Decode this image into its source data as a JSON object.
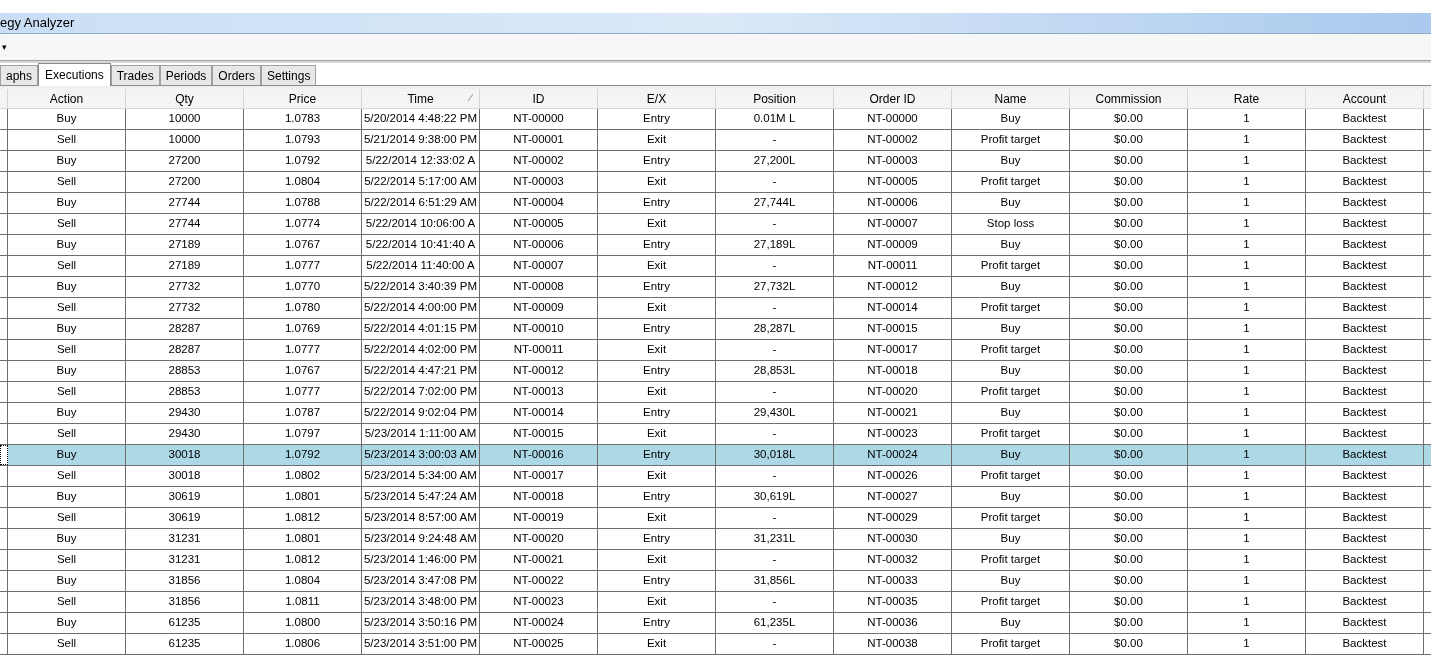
{
  "window": {
    "title": "egy Analyzer"
  },
  "toolbar": {
    "dropdown_caret": "▾"
  },
  "tabs": [
    {
      "label": "aphs",
      "selected": false
    },
    {
      "label": "Executions",
      "selected": true
    },
    {
      "label": "Trades",
      "selected": false
    },
    {
      "label": "Periods",
      "selected": false
    },
    {
      "label": "Orders",
      "selected": false
    },
    {
      "label": "Settings",
      "selected": false
    }
  ],
  "table": {
    "columns": [
      {
        "label": "Action",
        "sorted": false
      },
      {
        "label": "Qty",
        "sorted": false
      },
      {
        "label": "Price",
        "sorted": false
      },
      {
        "label": "Time",
        "sorted": true
      },
      {
        "label": "ID",
        "sorted": false
      },
      {
        "label": "E/X",
        "sorted": false
      },
      {
        "label": "Position",
        "sorted": false
      },
      {
        "label": "Order ID",
        "sorted": false
      },
      {
        "label": "Name",
        "sorted": false
      },
      {
        "label": "Commission",
        "sorted": false
      },
      {
        "label": "Rate",
        "sorted": false
      },
      {
        "label": "Account",
        "sorted": false
      }
    ],
    "rows": [
      {
        "selected": false,
        "cells": [
          "Buy",
          "10000",
          "1.0783",
          "5/20/2014 4:48:22 PM",
          "NT-00000",
          "Entry",
          "0.01M L",
          "NT-00000",
          "Buy",
          "$0.00",
          "1",
          "Backtest"
        ]
      },
      {
        "selected": false,
        "cells": [
          "Sell",
          "10000",
          "1.0793",
          "5/21/2014 9:38:00 PM",
          "NT-00001",
          "Exit",
          "-",
          "NT-00002",
          "Profit target",
          "$0.00",
          "1",
          "Backtest"
        ]
      },
      {
        "selected": false,
        "cells": [
          "Buy",
          "27200",
          "1.0792",
          "5/22/2014 12:33:02 A",
          "NT-00002",
          "Entry",
          "27,200L",
          "NT-00003",
          "Buy",
          "$0.00",
          "1",
          "Backtest"
        ]
      },
      {
        "selected": false,
        "cells": [
          "Sell",
          "27200",
          "1.0804",
          "5/22/2014 5:17:00 AM",
          "NT-00003",
          "Exit",
          "-",
          "NT-00005",
          "Profit target",
          "$0.00",
          "1",
          "Backtest"
        ]
      },
      {
        "selected": false,
        "cells": [
          "Buy",
          "27744",
          "1.0788",
          "5/22/2014 6:51:29 AM",
          "NT-00004",
          "Entry",
          "27,744L",
          "NT-00006",
          "Buy",
          "$0.00",
          "1",
          "Backtest"
        ]
      },
      {
        "selected": false,
        "cells": [
          "Sell",
          "27744",
          "1.0774",
          "5/22/2014 10:06:00 A",
          "NT-00005",
          "Exit",
          "-",
          "NT-00007",
          "Stop loss",
          "$0.00",
          "1",
          "Backtest"
        ]
      },
      {
        "selected": false,
        "cells": [
          "Buy",
          "27189",
          "1.0767",
          "5/22/2014 10:41:40 A",
          "NT-00006",
          "Entry",
          "27,189L",
          "NT-00009",
          "Buy",
          "$0.00",
          "1",
          "Backtest"
        ]
      },
      {
        "selected": false,
        "cells": [
          "Sell",
          "27189",
          "1.0777",
          "5/22/2014 11:40:00 A",
          "NT-00007",
          "Exit",
          "-",
          "NT-00011",
          "Profit target",
          "$0.00",
          "1",
          "Backtest"
        ]
      },
      {
        "selected": false,
        "cells": [
          "Buy",
          "27732",
          "1.0770",
          "5/22/2014 3:40:39 PM",
          "NT-00008",
          "Entry",
          "27,732L",
          "NT-00012",
          "Buy",
          "$0.00",
          "1",
          "Backtest"
        ]
      },
      {
        "selected": false,
        "cells": [
          "Sell",
          "27732",
          "1.0780",
          "5/22/2014 4:00:00 PM",
          "NT-00009",
          "Exit",
          "-",
          "NT-00014",
          "Profit target",
          "$0.00",
          "1",
          "Backtest"
        ]
      },
      {
        "selected": false,
        "cells": [
          "Buy",
          "28287",
          "1.0769",
          "5/22/2014 4:01:15 PM",
          "NT-00010",
          "Entry",
          "28,287L",
          "NT-00015",
          "Buy",
          "$0.00",
          "1",
          "Backtest"
        ]
      },
      {
        "selected": false,
        "cells": [
          "Sell",
          "28287",
          "1.0777",
          "5/22/2014 4:02:00 PM",
          "NT-00011",
          "Exit",
          "-",
          "NT-00017",
          "Profit target",
          "$0.00",
          "1",
          "Backtest"
        ]
      },
      {
        "selected": false,
        "cells": [
          "Buy",
          "28853",
          "1.0767",
          "5/22/2014 4:47:21 PM",
          "NT-00012",
          "Entry",
          "28,853L",
          "NT-00018",
          "Buy",
          "$0.00",
          "1",
          "Backtest"
        ]
      },
      {
        "selected": false,
        "cells": [
          "Sell",
          "28853",
          "1.0777",
          "5/22/2014 7:02:00 PM",
          "NT-00013",
          "Exit",
          "-",
          "NT-00020",
          "Profit target",
          "$0.00",
          "1",
          "Backtest"
        ]
      },
      {
        "selected": false,
        "cells": [
          "Buy",
          "29430",
          "1.0787",
          "5/22/2014 9:02:04 PM",
          "NT-00014",
          "Entry",
          "29,430L",
          "NT-00021",
          "Buy",
          "$0.00",
          "1",
          "Backtest"
        ]
      },
      {
        "selected": false,
        "cells": [
          "Sell",
          "29430",
          "1.0797",
          "5/23/2014 1:11:00 AM",
          "NT-00015",
          "Exit",
          "-",
          "NT-00023",
          "Profit target",
          "$0.00",
          "1",
          "Backtest"
        ]
      },
      {
        "selected": true,
        "cells": [
          "Buy",
          "30018",
          "1.0792",
          "5/23/2014 3:00:03 AM",
          "NT-00016",
          "Entry",
          "30,018L",
          "NT-00024",
          "Buy",
          "$0.00",
          "1",
          "Backtest"
        ]
      },
      {
        "selected": false,
        "cells": [
          "Sell",
          "30018",
          "1.0802",
          "5/23/2014 5:34:00 AM",
          "NT-00017",
          "Exit",
          "-",
          "NT-00026",
          "Profit target",
          "$0.00",
          "1",
          "Backtest"
        ]
      },
      {
        "selected": false,
        "cells": [
          "Buy",
          "30619",
          "1.0801",
          "5/23/2014 5:47:24 AM",
          "NT-00018",
          "Entry",
          "30,619L",
          "NT-00027",
          "Buy",
          "$0.00",
          "1",
          "Backtest"
        ]
      },
      {
        "selected": false,
        "cells": [
          "Sell",
          "30619",
          "1.0812",
          "5/23/2014 8:57:00 AM",
          "NT-00019",
          "Exit",
          "-",
          "NT-00029",
          "Profit target",
          "$0.00",
          "1",
          "Backtest"
        ]
      },
      {
        "selected": false,
        "cells": [
          "Buy",
          "31231",
          "1.0801",
          "5/23/2014 9:24:48 AM",
          "NT-00020",
          "Entry",
          "31,231L",
          "NT-00030",
          "Buy",
          "$0.00",
          "1",
          "Backtest"
        ]
      },
      {
        "selected": false,
        "cells": [
          "Sell",
          "31231",
          "1.0812",
          "5/23/2014 1:46:00 PM",
          "NT-00021",
          "Exit",
          "-",
          "NT-00032",
          "Profit target",
          "$0.00",
          "1",
          "Backtest"
        ]
      },
      {
        "selected": false,
        "cells": [
          "Buy",
          "31856",
          "1.0804",
          "5/23/2014 3:47:08 PM",
          "NT-00022",
          "Entry",
          "31,856L",
          "NT-00033",
          "Buy",
          "$0.00",
          "1",
          "Backtest"
        ]
      },
      {
        "selected": false,
        "cells": [
          "Sell",
          "31856",
          "1.0811",
          "5/23/2014 3:48:00 PM",
          "NT-00023",
          "Exit",
          "-",
          "NT-00035",
          "Profit target",
          "$0.00",
          "1",
          "Backtest"
        ]
      },
      {
        "selected": false,
        "cells": [
          "Buy",
          "61235",
          "1.0800",
          "5/23/2014 3:50:16 PM",
          "NT-00024",
          "Entry",
          "61,235L",
          "NT-00036",
          "Buy",
          "$0.00",
          "1",
          "Backtest"
        ]
      },
      {
        "selected": false,
        "cells": [
          "Sell",
          "61235",
          "1.0806",
          "5/23/2014 3:51:00 PM",
          "NT-00025",
          "Exit",
          "-",
          "NT-00038",
          "Profit target",
          "$0.00",
          "1",
          "Backtest"
        ]
      }
    ]
  }
}
